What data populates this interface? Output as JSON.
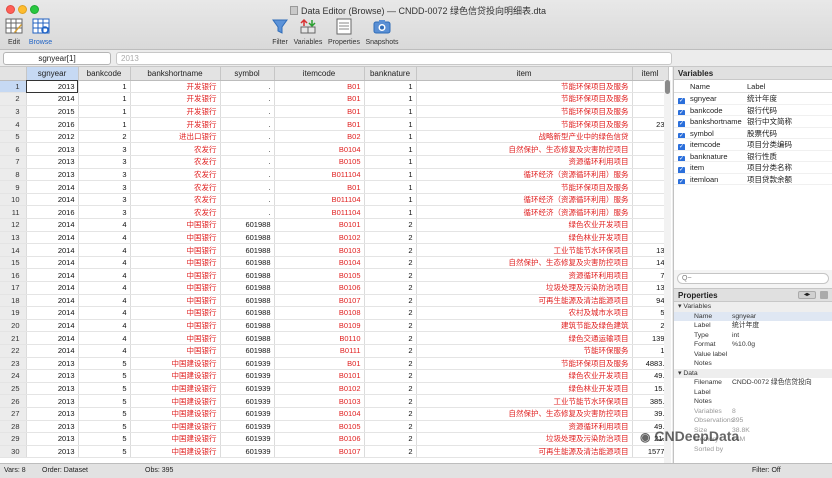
{
  "window": {
    "title": "Data Editor (Browse) — CNDD-0072 绿色信贷投向明细表.dta",
    "toolbar": [
      {
        "label": "Edit",
        "icon": "edit-grid-icon"
      },
      {
        "label": "Browse",
        "icon": "browse-grid-icon",
        "active": true
      },
      {
        "label": "Filter",
        "icon": "filter-icon"
      },
      {
        "label": "Variables",
        "icon": "variables-icon"
      },
      {
        "label": "Properties",
        "icon": "properties-icon"
      },
      {
        "label": "Snapshots",
        "icon": "camera-icon"
      }
    ]
  },
  "cmdbar": {
    "cell_ref": "sgnyear[1]",
    "cell_value": "2013"
  },
  "grid": {
    "columns": [
      "sgnyear",
      "bankcode",
      "bankshortname",
      "symbol",
      "itemcode",
      "banknature",
      "item",
      "iteml"
    ],
    "rows": [
      [
        "2013",
        "1",
        "开发银行",
        ".",
        "B01",
        "1",
        "节能环保项目及服务",
        ""
      ],
      [
        "2014",
        "1",
        "开发银行",
        ".",
        "B01",
        "1",
        "节能环保项目及服务",
        ""
      ],
      [
        "2015",
        "1",
        "开发银行",
        ".",
        "B01",
        "1",
        "节能环保项目及服务",
        ""
      ],
      [
        "2016",
        "1",
        "开发银行",
        ".",
        "B01",
        "1",
        "节能环保项目及服务",
        "23"
      ],
      [
        "2012",
        "2",
        "进出口银行",
        ".",
        "B02",
        "1",
        "战略新型产业中的绿色信贷",
        ""
      ],
      [
        "2013",
        "3",
        "农发行",
        ".",
        "B0104",
        "1",
        "自然保护、生态修复及灾害防控项目",
        ""
      ],
      [
        "2013",
        "3",
        "农发行",
        ".",
        "B0105",
        "1",
        "资源循环利用项目",
        ""
      ],
      [
        "2013",
        "3",
        "农发行",
        ".",
        "B011104",
        "1",
        "循环经济（资源循环利用）服务",
        ""
      ],
      [
        "2014",
        "3",
        "农发行",
        ".",
        "B01",
        "1",
        "节能环保项目及服务",
        ""
      ],
      [
        "2014",
        "3",
        "农发行",
        ".",
        "B011104",
        "1",
        "循环经济（资源循环利用）服务",
        ""
      ],
      [
        "2016",
        "3",
        "农发行",
        ".",
        "B011104",
        "1",
        "循环经济（资源循环利用）服务",
        ""
      ],
      [
        "2014",
        "4",
        "中国银行",
        "601988",
        "B0101",
        "2",
        "绿色农业开发项目",
        ""
      ],
      [
        "2014",
        "4",
        "中国银行",
        "601988",
        "B0102",
        "2",
        "绿色林业开发项目",
        ""
      ],
      [
        "2014",
        "4",
        "中国银行",
        "601988",
        "B0103",
        "2",
        "工业节能节水环保项目",
        "13"
      ],
      [
        "2014",
        "4",
        "中国银行",
        "601988",
        "B0104",
        "2",
        "自然保护、生态修复及灾害防控项目",
        "14"
      ],
      [
        "2014",
        "4",
        "中国银行",
        "601988",
        "B0105",
        "2",
        "资源循环利用项目",
        "7"
      ],
      [
        "2014",
        "4",
        "中国银行",
        "601988",
        "B0106",
        "2",
        "垃圾处理及污染防治项目",
        "13"
      ],
      [
        "2014",
        "4",
        "中国银行",
        "601988",
        "B0107",
        "2",
        "可再生能源及清洁能源项目",
        "94"
      ],
      [
        "2014",
        "4",
        "中国银行",
        "601988",
        "B0108",
        "2",
        "农村及城市水项目",
        "5"
      ],
      [
        "2014",
        "4",
        "中国银行",
        "601988",
        "B0109",
        "2",
        "建筑节能及绿色建筑",
        "2"
      ],
      [
        "2014",
        "4",
        "中国银行",
        "601988",
        "B0110",
        "2",
        "绿色交通运输项目",
        "139"
      ],
      [
        "2014",
        "4",
        "中国银行",
        "601988",
        "B0111",
        "2",
        "节能环保服务",
        "1"
      ],
      [
        "2013",
        "5",
        "中国建设银行",
        "601939",
        "B01",
        "2",
        "节能环保项目及服务",
        "4883."
      ],
      [
        "2013",
        "5",
        "中国建设银行",
        "601939",
        "B0101",
        "2",
        "绿色农业开发项目",
        "49."
      ],
      [
        "2013",
        "5",
        "中国建设银行",
        "601939",
        "B0102",
        "2",
        "绿色林业开发项目",
        "15."
      ],
      [
        "2013",
        "5",
        "中国建设银行",
        "601939",
        "B0103",
        "2",
        "工业节能节水环保项目",
        "385."
      ],
      [
        "2013",
        "5",
        "中国建设银行",
        "601939",
        "B0104",
        "2",
        "自然保护、生态修复及灾害防控项目",
        "39."
      ],
      [
        "2013",
        "5",
        "中国建设银行",
        "601939",
        "B0105",
        "2",
        "资源循环利用项目",
        "49."
      ],
      [
        "2013",
        "5",
        "中国建设银行",
        "601939",
        "B0106",
        "2",
        "垃圾处理及污染防治项目",
        "21."
      ],
      [
        "2013",
        "5",
        "中国建设银行",
        "601939",
        "B0107",
        "2",
        "可再生能源及清洁能源项目",
        "1577"
      ]
    ]
  },
  "variables_panel": {
    "title": "Variables",
    "col_name": "Name",
    "col_label": "Label",
    "items": [
      {
        "name": "sgnyear",
        "label": "统计年度"
      },
      {
        "name": "bankcode",
        "label": "银行代码"
      },
      {
        "name": "bankshortname",
        "label": "银行中文简称"
      },
      {
        "name": "symbol",
        "label": "股票代码"
      },
      {
        "name": "itemcode",
        "label": "项目分类编码"
      },
      {
        "name": "banknature",
        "label": "银行性质"
      },
      {
        "name": "item",
        "label": "项目分类名称"
      },
      {
        "name": "itemloan",
        "label": "项目贷款余额"
      }
    ],
    "search_placeholder": "Q~"
  },
  "properties_panel": {
    "title": "Properties",
    "section_variables": "Variables",
    "var_props": [
      {
        "k": "Name",
        "v": "sgnyear"
      },
      {
        "k": "Label",
        "v": "统计年度"
      },
      {
        "k": "Type",
        "v": "int"
      },
      {
        "k": "Format",
        "v": "%10.0g"
      },
      {
        "k": "Value label",
        "v": ""
      },
      {
        "k": "Notes",
        "v": ""
      }
    ],
    "section_data": "Data",
    "data_props": [
      {
        "k": "Filename",
        "v": "CNDD-0072 绿色信贷投向"
      },
      {
        "k": "Label",
        "v": ""
      },
      {
        "k": "Notes",
        "v": ""
      },
      {
        "k": "Variables",
        "v": "8"
      },
      {
        "k": "Observations",
        "v": "395"
      },
      {
        "k": "Size",
        "v": "38.8K"
      },
      {
        "k": "Memory",
        "v": "64M"
      },
      {
        "k": "Sorted by",
        "v": ""
      }
    ]
  },
  "status": {
    "vars": "Vars: 8",
    "order": "Order: Dataset",
    "obs": "Obs: 395",
    "filter": "Filter: Off"
  },
  "watermark": "CNDeepData"
}
